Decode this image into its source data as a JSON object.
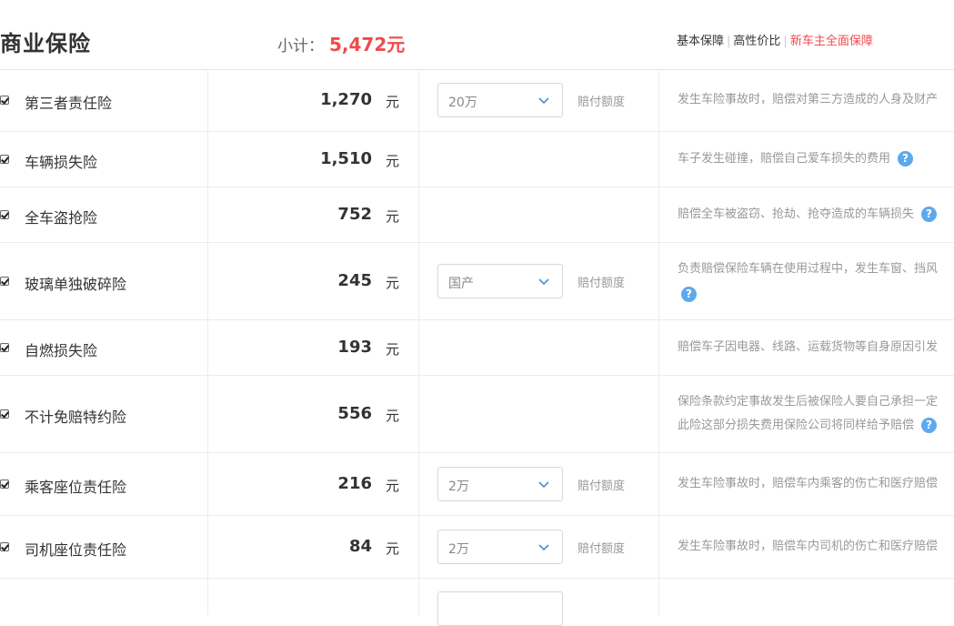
{
  "header": {
    "title": "商业保险",
    "subtotal_label": "小计：",
    "subtotal_amount": "5,472元",
    "plans": [
      {
        "label": "基本保障"
      },
      {
        "label": "高性价比"
      },
      {
        "label": "新车主全面保障"
      }
    ],
    "active_plan_color": "#f04b4b"
  },
  "rows": [
    {
      "name": "第三者责任险",
      "price": "1,270",
      "unit": "元",
      "select": "20万",
      "limit_label": "赔付额度",
      "desc": [
        "发生车险事故时，赔偿对第三方造成的人身及财产"
      ]
    },
    {
      "name": "车辆损失险",
      "price": "1,510",
      "unit": "元",
      "desc": [
        "车子发生碰撞，赔偿自己爱车损失的费用"
      ]
    },
    {
      "name": "全车盗抢险",
      "price": "752",
      "unit": "元",
      "desc": [
        "赔偿全车被盗窃、抢劫、抢夺造成的车辆损失"
      ]
    },
    {
      "name": "玻璃单独破碎险",
      "price": "245",
      "unit": "元",
      "select": "国产",
      "limit_label": "赔付额度",
      "desc": [
        "负责赔偿保险车辆在使用过程中，发生车窗、挡风"
      ]
    },
    {
      "name": "自燃损失险",
      "price": "193",
      "unit": "元",
      "desc": [
        "赔偿车子因电器、线路、运载货物等自身原因引发"
      ]
    },
    {
      "name": "不计免赔特约险",
      "price": "556",
      "unit": "元",
      "desc": [
        "保险条款约定事故发生后被保险人要自己承担一定",
        "此险这部分损失费用保险公司将同样给予赔偿"
      ]
    },
    {
      "name": "乘客座位责任险",
      "price": "216",
      "unit": "元",
      "select": "2万",
      "limit_label": "赔付额度",
      "desc": [
        "发生车险事故时，赔偿车内乘客的伤亡和医疗赔偿"
      ]
    },
    {
      "name": "司机座位责任险",
      "price": "84",
      "unit": "元",
      "select": "2万",
      "limit_label": "赔付额度",
      "desc": [
        "发生车险事故时，赔偿车内司机的伤亡和医疗赔偿"
      ]
    }
  ],
  "help_glyph": "?",
  "help_color": "#5ea9ee"
}
